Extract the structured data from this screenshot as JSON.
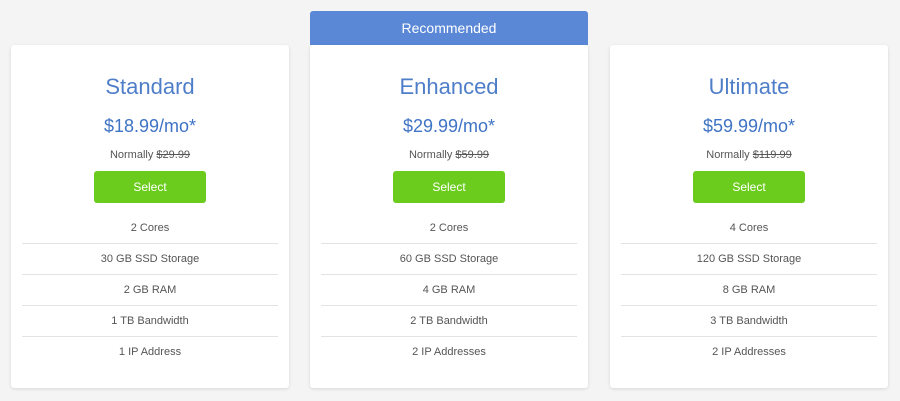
{
  "recommended_label": "Recommended",
  "colors": {
    "ribbon": "#5a88d6",
    "plan_name": "#4f7ec9",
    "price": "#3f73c4",
    "select_button": "#6ccc1d",
    "page_background": "#f4f4f4"
  },
  "plans": [
    {
      "name": "Standard",
      "price": "$18.99/mo*",
      "normally_label": "Normally",
      "normally_price": "$29.99",
      "button_label": "Select",
      "features": [
        "2 Cores",
        "30 GB SSD Storage",
        "2 GB RAM",
        "1 TB Bandwidth",
        "1 IP Address"
      ]
    },
    {
      "name": "Enhanced",
      "price": "$29.99/mo*",
      "normally_label": "Normally",
      "normally_price": "$59.99",
      "button_label": "Select",
      "features": [
        "2 Cores",
        "60 GB SSD Storage",
        "4 GB RAM",
        "2 TB Bandwidth",
        "2 IP Addresses"
      ]
    },
    {
      "name": "Ultimate",
      "price": "$59.99/mo*",
      "normally_label": "Normally",
      "normally_price": "$119.99",
      "button_label": "Select",
      "features": [
        "4 Cores",
        "120 GB SSD Storage",
        "8 GB RAM",
        "3 TB Bandwidth",
        "2 IP Addresses"
      ]
    }
  ]
}
